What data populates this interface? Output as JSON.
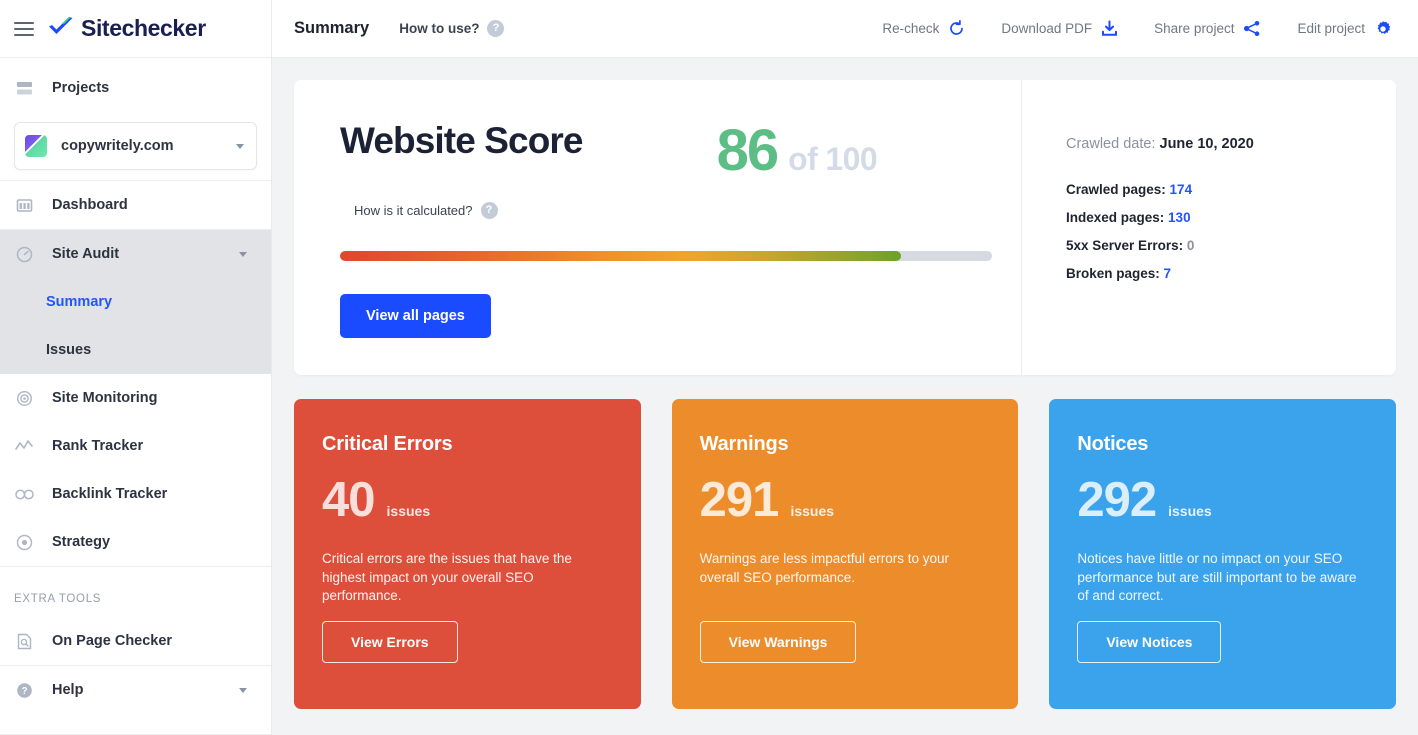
{
  "brand": {
    "name": "Sitechecker",
    "logo_icon": "check-logo-icon",
    "menu_icon": "hamburger-icon"
  },
  "sidebar": {
    "projects_label": "Projects",
    "projects_icon": "projects-icon",
    "project_selector": {
      "name": "copywritely.com",
      "icon": "project-gradient-icon",
      "caret_icon": "chevron-down-icon"
    },
    "items": [
      {
        "label": "Dashboard",
        "icon": "dashboard-icon"
      },
      {
        "label": "Site Audit",
        "icon": "gauge-icon",
        "caret_icon": "chevron-down-icon"
      },
      {
        "label": "Site Monitoring",
        "icon": "monitoring-icon"
      },
      {
        "label": "Rank Tracker",
        "icon": "trend-line-icon"
      },
      {
        "label": "Backlink Tracker",
        "icon": "link-icon"
      },
      {
        "label": "Strategy",
        "icon": "target-icon"
      }
    ],
    "sub_items": [
      {
        "label": "Summary",
        "active": true
      },
      {
        "label": "Issues",
        "active": false
      }
    ],
    "extra_tools_label": "EXTRA TOOLS",
    "extra_items": [
      {
        "label": "On Page Checker",
        "icon": "page-search-icon"
      },
      {
        "label": "Help",
        "icon": "help-circle-icon",
        "caret_icon": "chevron-down-icon"
      }
    ]
  },
  "topbar": {
    "title": "Summary",
    "how_to_use": "How to use?",
    "how_to_use_icon": "question-mark-icon",
    "actions": [
      {
        "label": "Re-check",
        "icon": "refresh-icon"
      },
      {
        "label": "Download PDF",
        "icon": "download-icon"
      },
      {
        "label": "Share project",
        "icon": "share-icon"
      },
      {
        "label": "Edit project",
        "icon": "gear-icon"
      }
    ]
  },
  "score_card": {
    "title": "Website Score",
    "score": "86",
    "score_of": "of 100",
    "how_calculated": "How is it calculated?",
    "how_calculated_icon": "question-mark-icon",
    "progress_percent": 86,
    "view_all_pages": "View all pages",
    "crawled_date_label": "Crawled date:",
    "crawled_date_value": "June 10, 2020",
    "stats": [
      {
        "label": "Crawled pages:",
        "value": "174",
        "value_style": "blue"
      },
      {
        "label": "Indexed pages:",
        "value": "130",
        "value_style": "blue"
      },
      {
        "label": "5xx Server Errors:",
        "value": "0",
        "value_style": "gray"
      },
      {
        "label": "Broken pages:",
        "value": "7",
        "value_style": "blue"
      }
    ]
  },
  "issue_cards": [
    {
      "title": "Critical Errors",
      "count": "40",
      "unit": "issues",
      "description": "Critical errors are the issues that have the highest impact on your overall SEO performance.",
      "button": "View Errors",
      "color": "#dd4f3a"
    },
    {
      "title": "Warnings",
      "count": "291",
      "unit": "issues",
      "description": "Warnings are less impactful errors to your overall SEO performance.",
      "button": "View Warnings",
      "color": "#ec8c2b"
    },
    {
      "title": "Notices",
      "count": "292",
      "unit": "issues",
      "description": "Notices have little or no impact on your SEO performance but are still important to be aware of and correct.",
      "button": "View Notices",
      "color": "#3ba3eb"
    }
  ],
  "colors": {
    "accent_blue": "#1b4bff",
    "link_blue": "#2354ff",
    "score_green": "#5cbe84",
    "brand_navy": "#1a1f52"
  }
}
